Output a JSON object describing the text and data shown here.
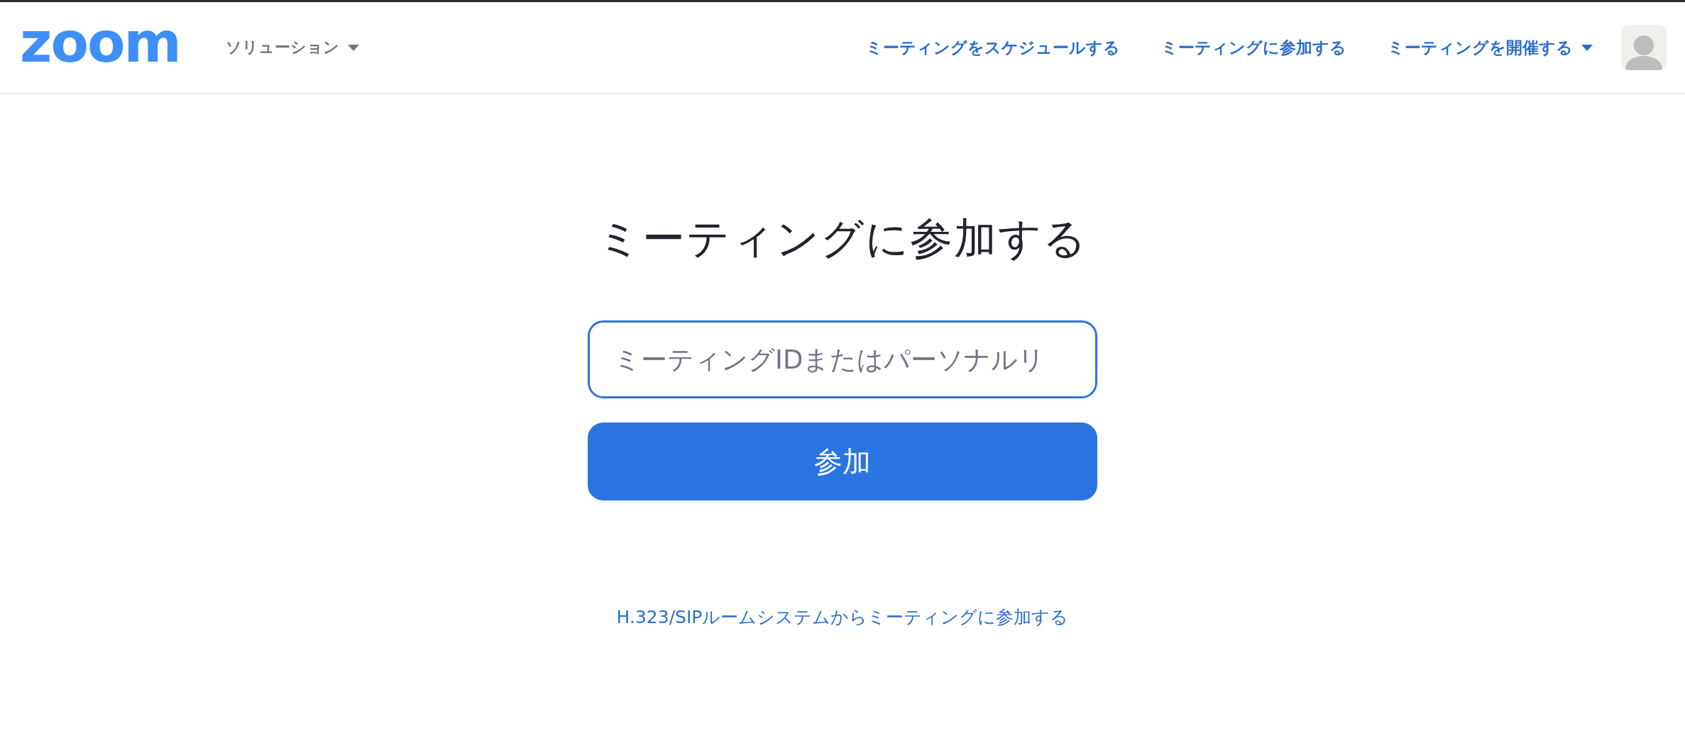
{
  "header": {
    "logo": "zoom",
    "menu": {
      "label": "ソリューション",
      "dropdown": true
    },
    "nav": [
      {
        "label": "ミーティングをスケジュールする",
        "dropdown": false
      },
      {
        "label": "ミーティングに参加する",
        "dropdown": false
      },
      {
        "label": "ミーティングを開催する",
        "dropdown": true
      }
    ]
  },
  "main": {
    "title": "ミーティングに参加する",
    "meeting_field": {
      "placeholder": "ミーティングIDまたはパーソナルリ"
    },
    "join_button": "参加",
    "sip_link": "H.323/SIPルームシステムからミーティングに参加する"
  }
}
